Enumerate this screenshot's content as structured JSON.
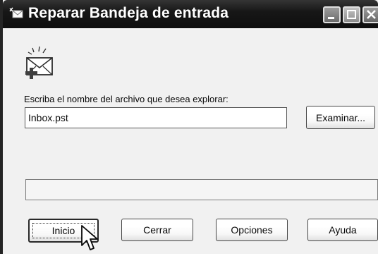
{
  "window": {
    "title": "Reparar Bandeja de entrada"
  },
  "form": {
    "prompt_label": "Escriba el nombre del archivo que desea explorar:",
    "file_value": "Inbox.pst",
    "browse_label": "Examinar..."
  },
  "progress": {
    "value": 0
  },
  "buttons": {
    "start": "Inicio",
    "close": "Cerrar",
    "options": "Opciones",
    "help": "Ayuda"
  },
  "icons": {
    "title": "inbox-repair-icon",
    "app": "envelope-repair-icon",
    "cursor": "mouse-pointer-icon"
  },
  "colors": {
    "titlebar": "#1f1f1f",
    "dialog_face": "#ece9d8",
    "button_border": "#4a4a4a"
  }
}
